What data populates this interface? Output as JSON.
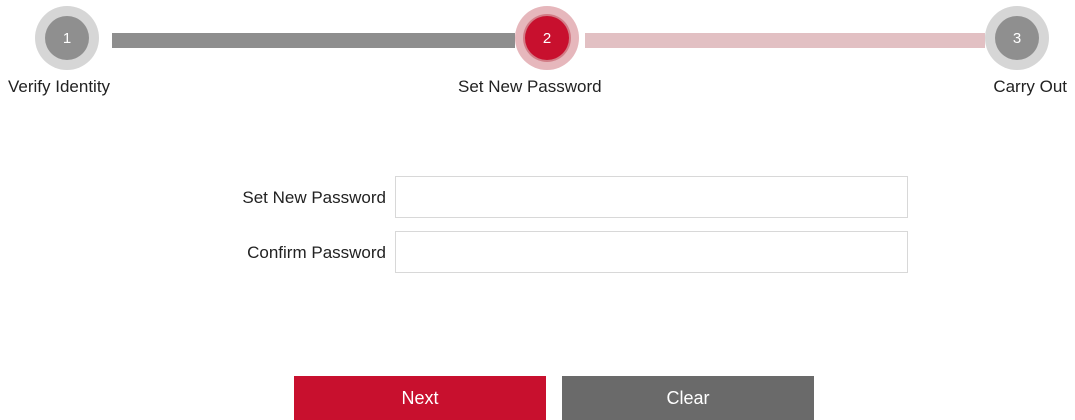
{
  "stepper": {
    "steps": [
      {
        "number": "1",
        "label": "Verify Identity",
        "state": "completed"
      },
      {
        "number": "2",
        "label": "Set New Password",
        "state": "active"
      },
      {
        "number": "3",
        "label": "Carry Out",
        "state": "pending"
      }
    ],
    "colors": {
      "active": "#c8102e",
      "inactive": "#8f8f8f",
      "completed_connector": "#8e8e8e",
      "pending_connector": "#e2c0c3"
    }
  },
  "form": {
    "new_password": {
      "label": "Set New Password",
      "value": "",
      "placeholder": ""
    },
    "confirm_password": {
      "label": "Confirm Password",
      "value": "",
      "placeholder": ""
    }
  },
  "buttons": {
    "next_label": "Next",
    "clear_label": "Clear",
    "colors": {
      "next": "#c8102e",
      "clear": "#6a6a6a"
    }
  }
}
